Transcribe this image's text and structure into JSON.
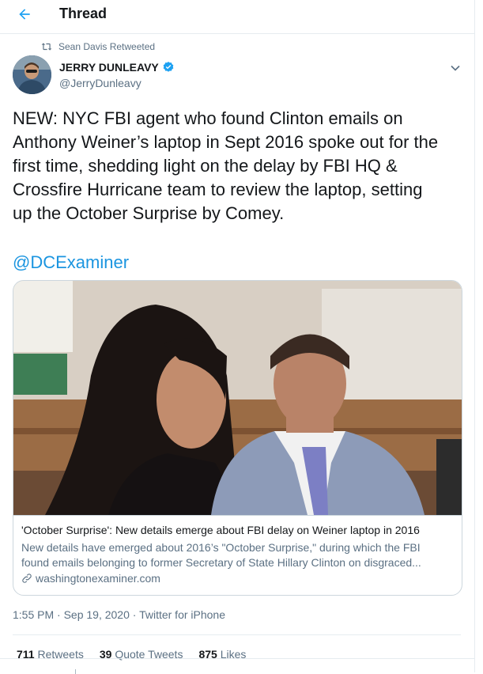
{
  "header": {
    "title": "Thread",
    "back_icon": "arrow-left-icon"
  },
  "colors": {
    "accent": "#1da1f2",
    "link": "#1b95e0",
    "secondary_text": "#5b7083",
    "border": "#e6ecf0"
  },
  "retweet": {
    "text": "Sean Davis Retweeted",
    "icon": "retweet-icon"
  },
  "author": {
    "display_name": "JERRY DUNLEAVY",
    "handle": "@JerryDunleavy",
    "verified": true
  },
  "tweet": {
    "text": "NEW: NYC FBI agent who found Clinton emails on\nAnthony Weiner’s laptop in Sept 2016 spoke out for the\nfirst time, shedding light on the delay by FBI HQ &\nCrossfire Hurricane team to review the laptop, setting\nup the October Surprise by Comey.",
    "mention": "@DCExaminer"
  },
  "card": {
    "title": "'October Surprise': New details emerge about FBI delay on Weiner laptop in 2016",
    "description_line1": "New details have emerged about 2016’s \"October Surprise,\" during which the FBI",
    "description_line2": "found emails belonging to former Secretary of State Hillary Clinton on disgraced...",
    "domain": "washingtonexaminer.com"
  },
  "meta": {
    "timestamp": "1:55 PM · Sep 19, 2020 · Twitter for iPhone"
  },
  "stats": {
    "retweets_count": "711",
    "retweets_label": "Retweets",
    "quotes_count": "39",
    "quotes_label": "Quote Tweets",
    "likes_count": "875",
    "likes_label": "Likes"
  }
}
